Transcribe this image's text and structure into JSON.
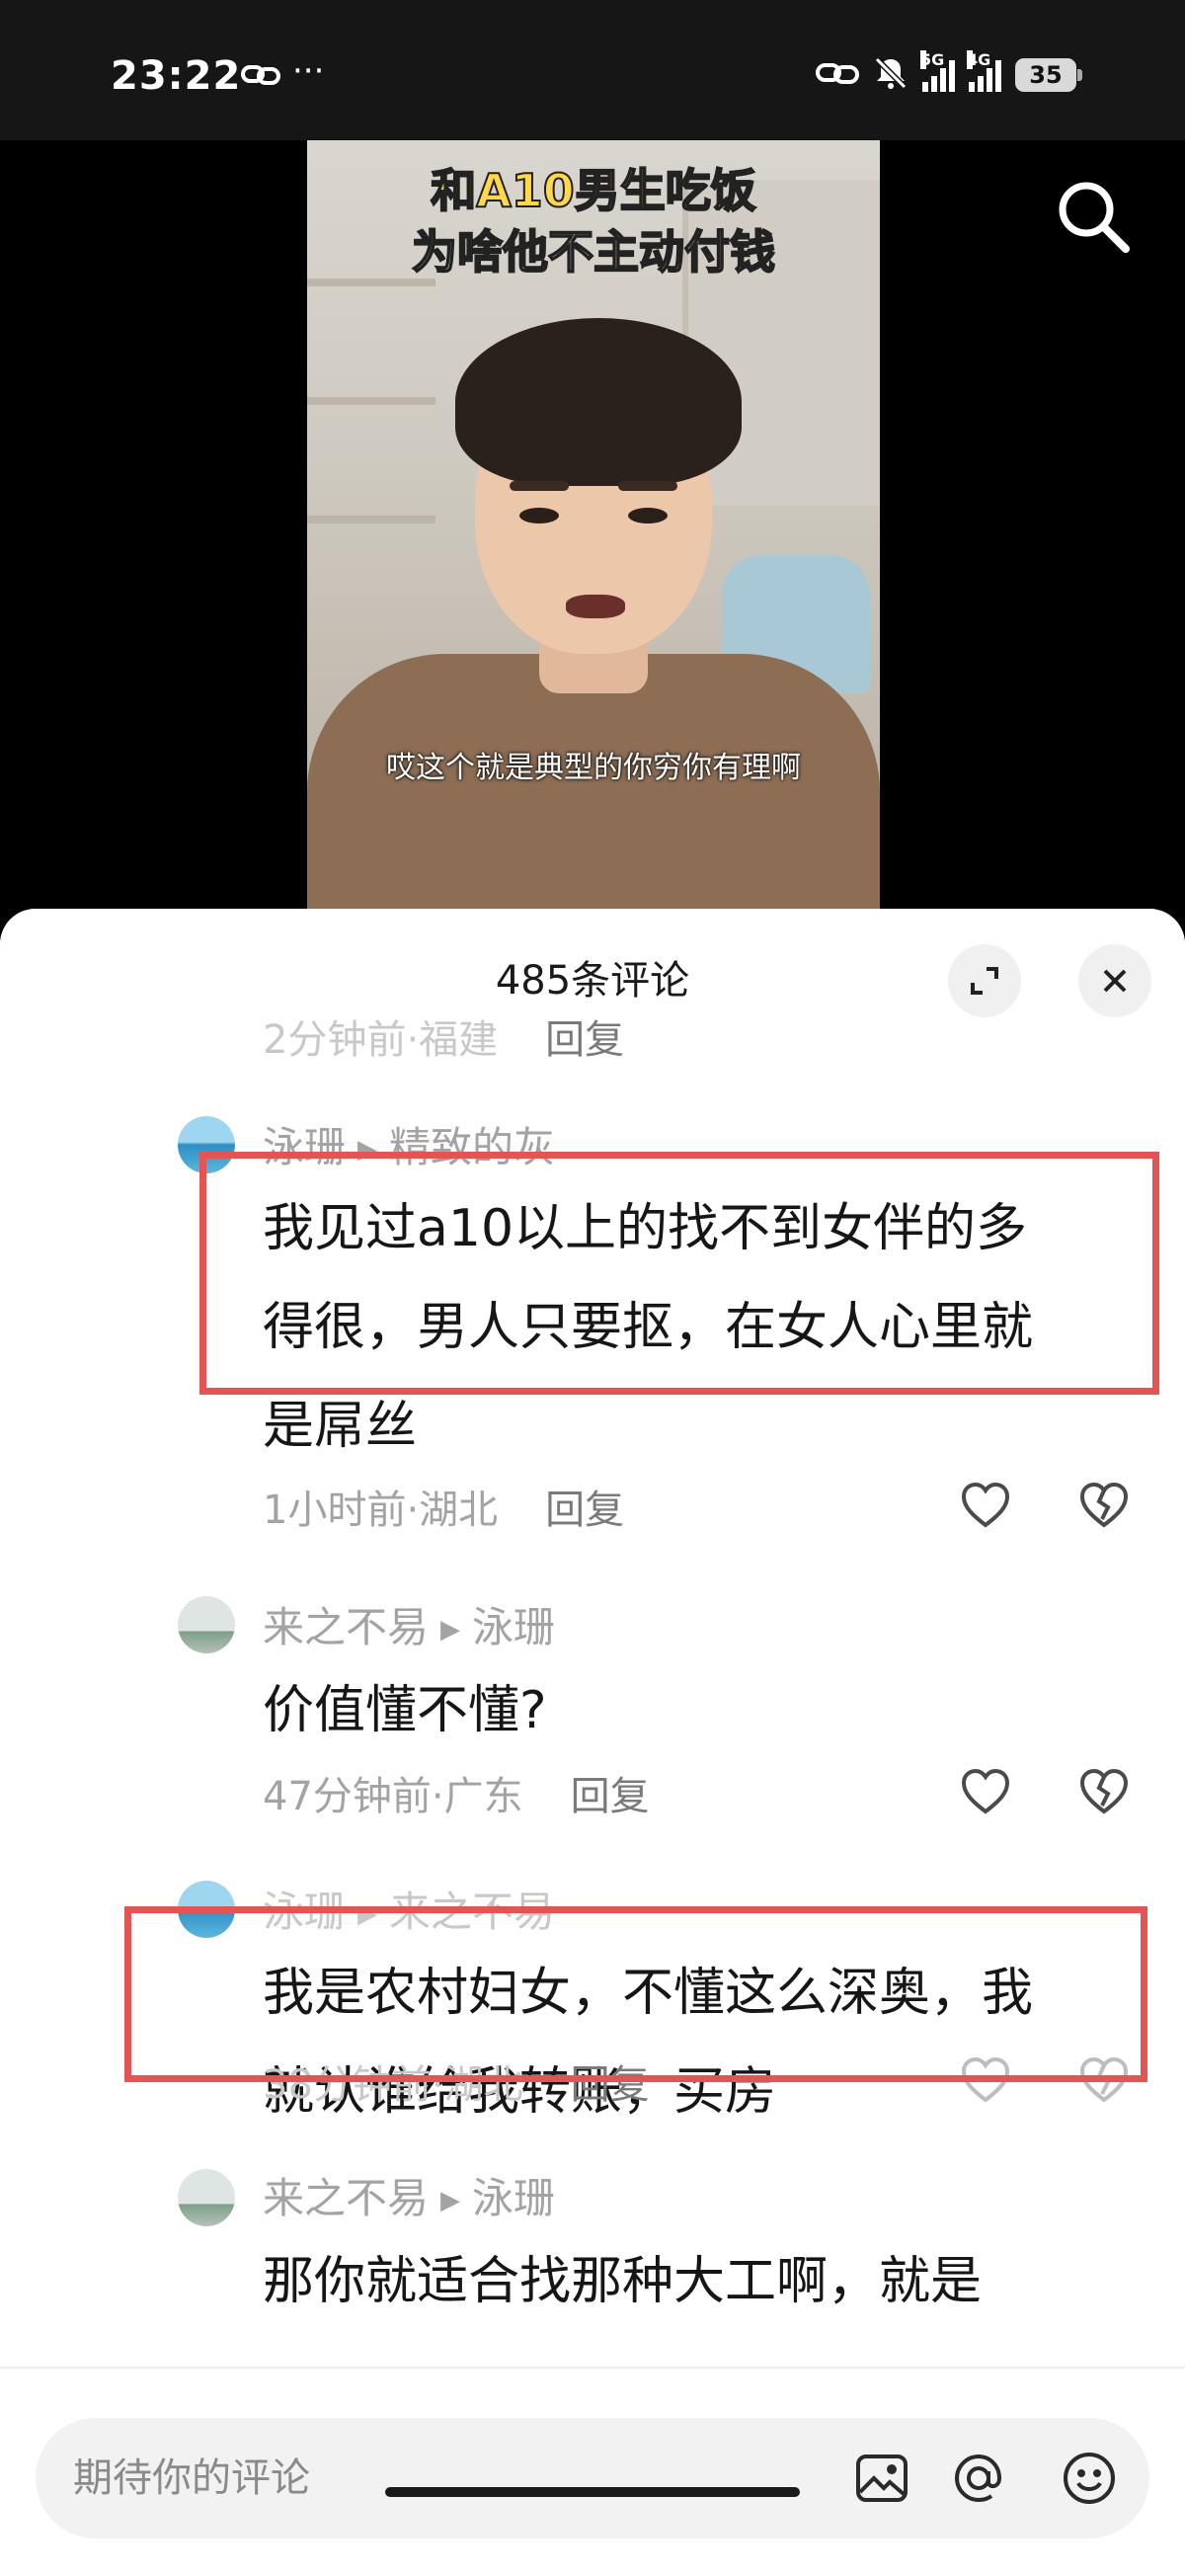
{
  "status_bar": {
    "time": "23:22",
    "dots": "···",
    "battery": "35",
    "net1": "5G",
    "net2": "4G"
  },
  "video": {
    "title_line1": "和A10男生吃饭",
    "title_line2": "为啥他不主动付钱",
    "subtitle": "哎这个就是典型的你穷你有理啊"
  },
  "comments_panel": {
    "count_label": "485条评论",
    "partial_top_meta": {
      "time": "2分钟前",
      "location": "福建",
      "reply": "回复"
    },
    "comments": [
      {
        "author": "泳珊",
        "reply_to": "精致的灰",
        "lines": [
          "我见过a10以上的找不到女伴的多",
          "得很，男人只要抠，在女人心里就",
          "是屌丝"
        ],
        "time": "1小时前",
        "location": "湖北",
        "reply": "回复"
      },
      {
        "author": "来之不易",
        "reply_to": "泳珊",
        "lines": [
          "价值懂不懂?"
        ],
        "time": "47分钟前",
        "location": "广东",
        "reply": "回复"
      },
      {
        "author": "泳珊",
        "reply_to": "来之不易",
        "lines": [
          "我是农村妇女，不懂这么深奥，我",
          "就认谁给我转账，买房"
        ],
        "time": "38分钟前",
        "location": "湖北",
        "reply": "回复"
      },
      {
        "author": "来之不易",
        "reply_to": "泳珊",
        "lines": [
          "那你就适合找那种大工啊，就是"
        ]
      }
    ]
  },
  "input_bar": {
    "placeholder": "期待你的评论"
  },
  "colors": {
    "highlight": "#e35453",
    "meta_gray": "#a3a3a3"
  }
}
